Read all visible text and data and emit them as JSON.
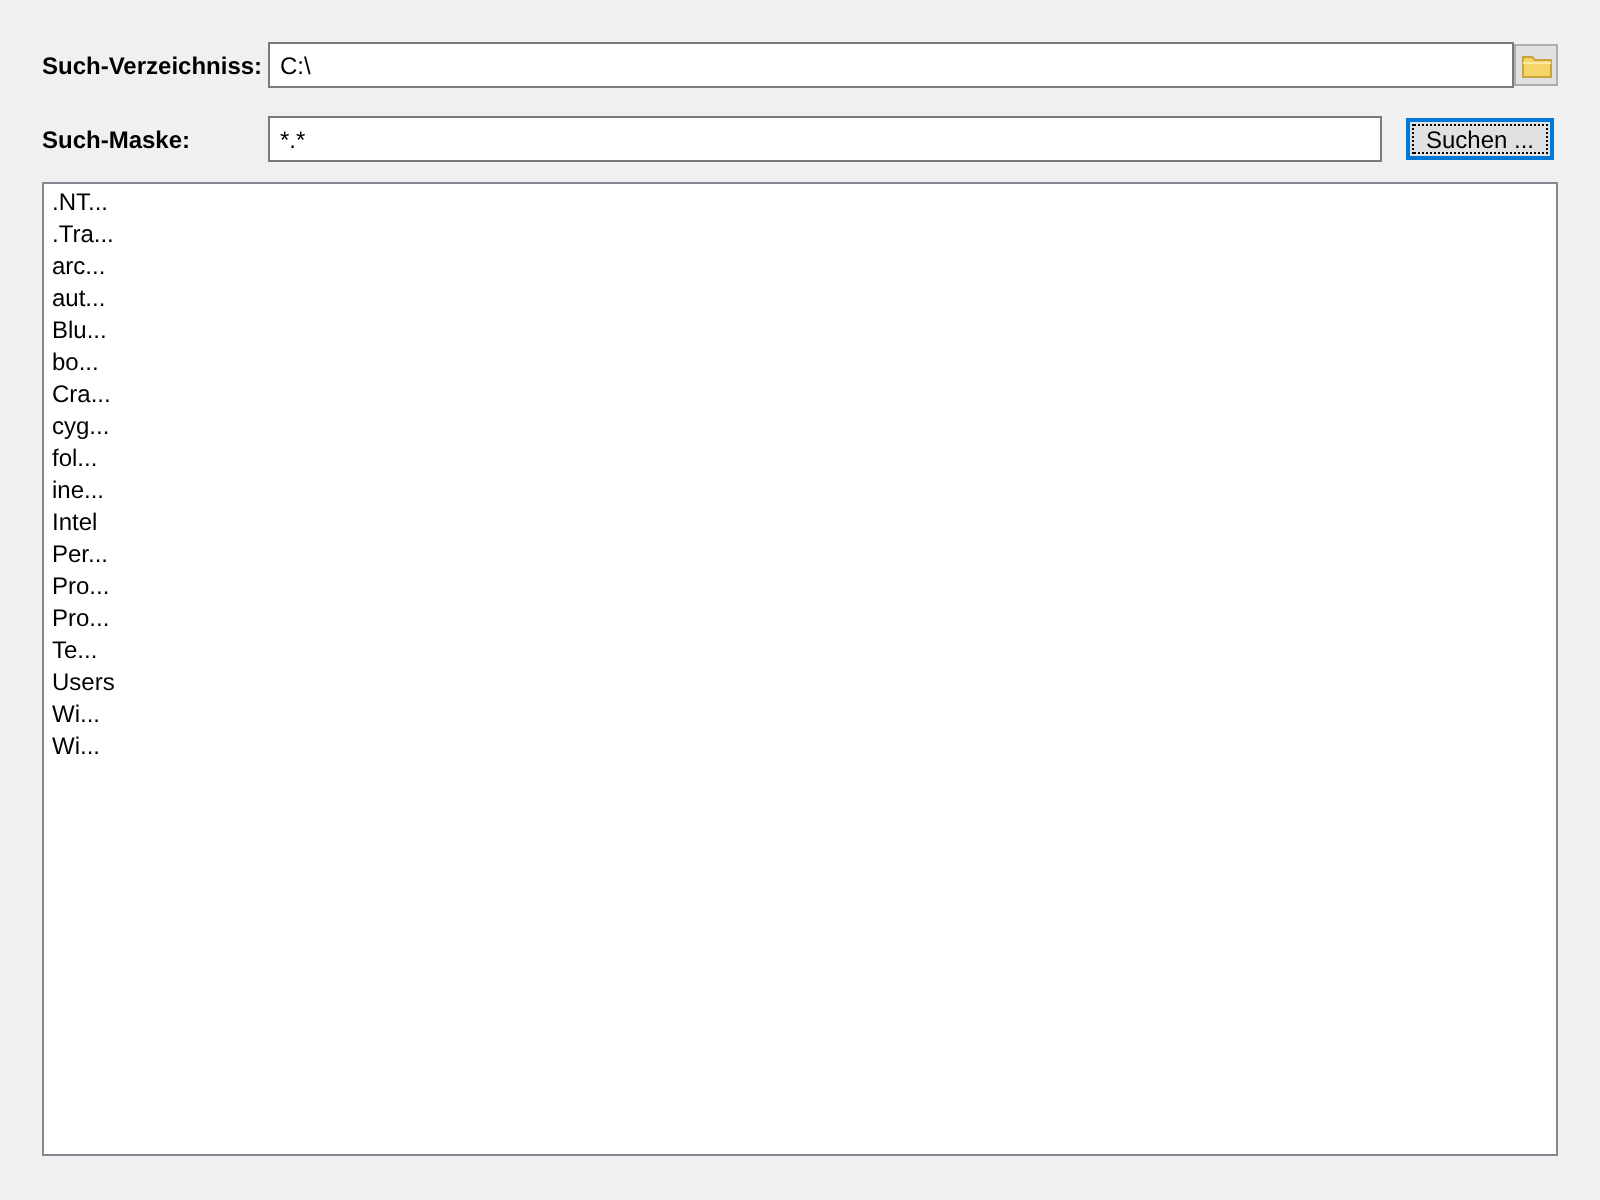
{
  "directory": {
    "label": "Such-Verzeichniss:",
    "value": "C:\\"
  },
  "mask": {
    "label": "Such-Maske:",
    "value": "*.*"
  },
  "search_button": {
    "label": "Suchen ...",
    "focused": true
  },
  "results": [
    {
      "label": ".NT...",
      "selected": false
    },
    {
      "label": ".Tra...",
      "selected": false
    },
    {
      "label": "arc...",
      "selected": false
    },
    {
      "label": "aut...",
      "selected": false
    },
    {
      "label": "Blu...",
      "selected": false
    },
    {
      "label": "bo...",
      "selected": false
    },
    {
      "label": "Cra...",
      "selected": false
    },
    {
      "label": "cyg...",
      "selected": false
    },
    {
      "label": "fol...",
      "selected": false
    },
    {
      "label": "ine...",
      "selected": false
    },
    {
      "label": "Intel",
      "selected": false
    },
    {
      "label": "Per...",
      "selected": false
    },
    {
      "label": "Pro...",
      "selected": false
    },
    {
      "label": "Pro...",
      "selected": false
    },
    {
      "label": "Te...",
      "selected": false
    },
    {
      "label": "Users",
      "selected": false
    },
    {
      "label": "Wi...",
      "selected": false
    },
    {
      "label": "Wi...",
      "selected": false
    }
  ]
}
